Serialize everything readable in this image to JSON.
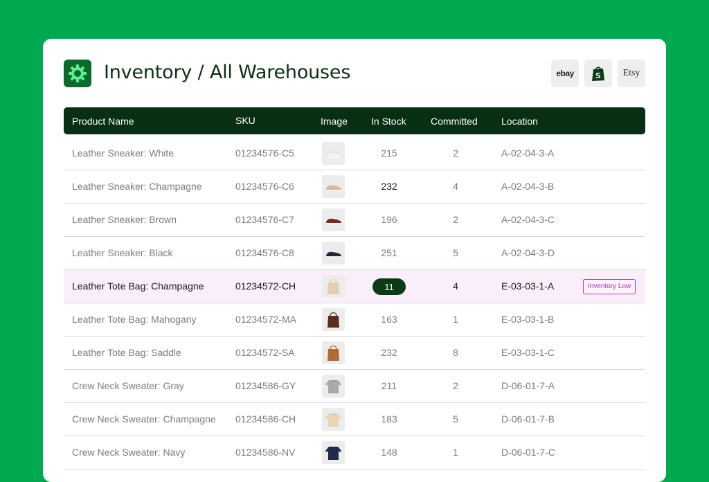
{
  "header": {
    "title": "Inventory / All Warehouses",
    "logo_icon": "gear-icon",
    "channels": [
      {
        "name": "ebay",
        "label": "ebay",
        "icon": "ebay-logo"
      },
      {
        "name": "shopify",
        "label": "",
        "icon": "shopify-bag-icon"
      },
      {
        "name": "etsy",
        "label": "Etsy",
        "icon": "etsy-logo"
      }
    ]
  },
  "table": {
    "columns": [
      "Product Name",
      "SKU",
      "Image",
      "In Stock",
      "Committed",
      "Location"
    ],
    "rows": [
      {
        "name": "Leather Sneaker: White",
        "sku": "01234576-C5",
        "image": "sneaker-white",
        "stock": "215",
        "committed": "2",
        "location": "A-02-04-3-A"
      },
      {
        "name": "Leather Sneaker: Champagne",
        "sku": "01234576-C6",
        "image": "sneaker-champagne",
        "stock": "232",
        "committed": "4",
        "location": "A-02-04-3-B"
      },
      {
        "name": "Leather Sneaker: Brown",
        "sku": "01234576-C7",
        "image": "sneaker-brown",
        "stock": "196",
        "committed": "2",
        "location": "A-02-04-3-C"
      },
      {
        "name": "Leather Sneaker: Black",
        "sku": "01234576-C8",
        "image": "sneaker-black",
        "stock": "251",
        "committed": "5",
        "location": "A-02-04-3-D"
      },
      {
        "name": "Leather Tote Bag: Champagne",
        "sku": "01234572-CH",
        "image": "tote-champagne",
        "stock": "11",
        "committed": "4",
        "location": "E-03-03-1-A",
        "badge": "Inventory Low"
      },
      {
        "name": "Leather Tote Bag: Mahogany",
        "sku": "01234572-MA",
        "image": "tote-mahogany",
        "stock": "163",
        "committed": "1",
        "location": "E-03-03-1-B"
      },
      {
        "name": "Leather Tote Bag: Saddle",
        "sku": "01234572-SA",
        "image": "tote-saddle",
        "stock": "232",
        "committed": "8",
        "location": "E-03-03-1-C"
      },
      {
        "name": "Crew Neck Sweater: Gray",
        "sku": "01234586-GY",
        "image": "sweater-gray",
        "stock": "211",
        "committed": "2",
        "location": "D-06-01-7-A"
      },
      {
        "name": "Crew Neck Sweater: Champagne",
        "sku": "01234586-CH",
        "image": "sweater-champagne",
        "stock": "183",
        "committed": "5",
        "location": "D-06-01-7-B"
      },
      {
        "name": "Crew Neck Sweater: Navy",
        "sku": "01234586-NV",
        "image": "sweater-navy",
        "stock": "148",
        "committed": "1",
        "location": "D-06-01-7-C"
      }
    ]
  },
  "colors": {
    "background": "#00a94f",
    "header_row": "#082f12",
    "alert_row": "#fbeefb",
    "badge": "#c72fc7",
    "sneaker-white": "#f2f2f2",
    "sneaker-champagne": "#d9b99b",
    "sneaker-brown": "#7a2a22",
    "sneaker-black": "#1c2b3a",
    "tote-champagne": "#e3cfb0",
    "tote-mahogany": "#5a2e1a",
    "tote-saddle": "#b06a35",
    "sweater-gray": "#a9a9a9",
    "sweater-champagne": "#e9d4b4",
    "sweater-navy": "#1d2a48"
  }
}
